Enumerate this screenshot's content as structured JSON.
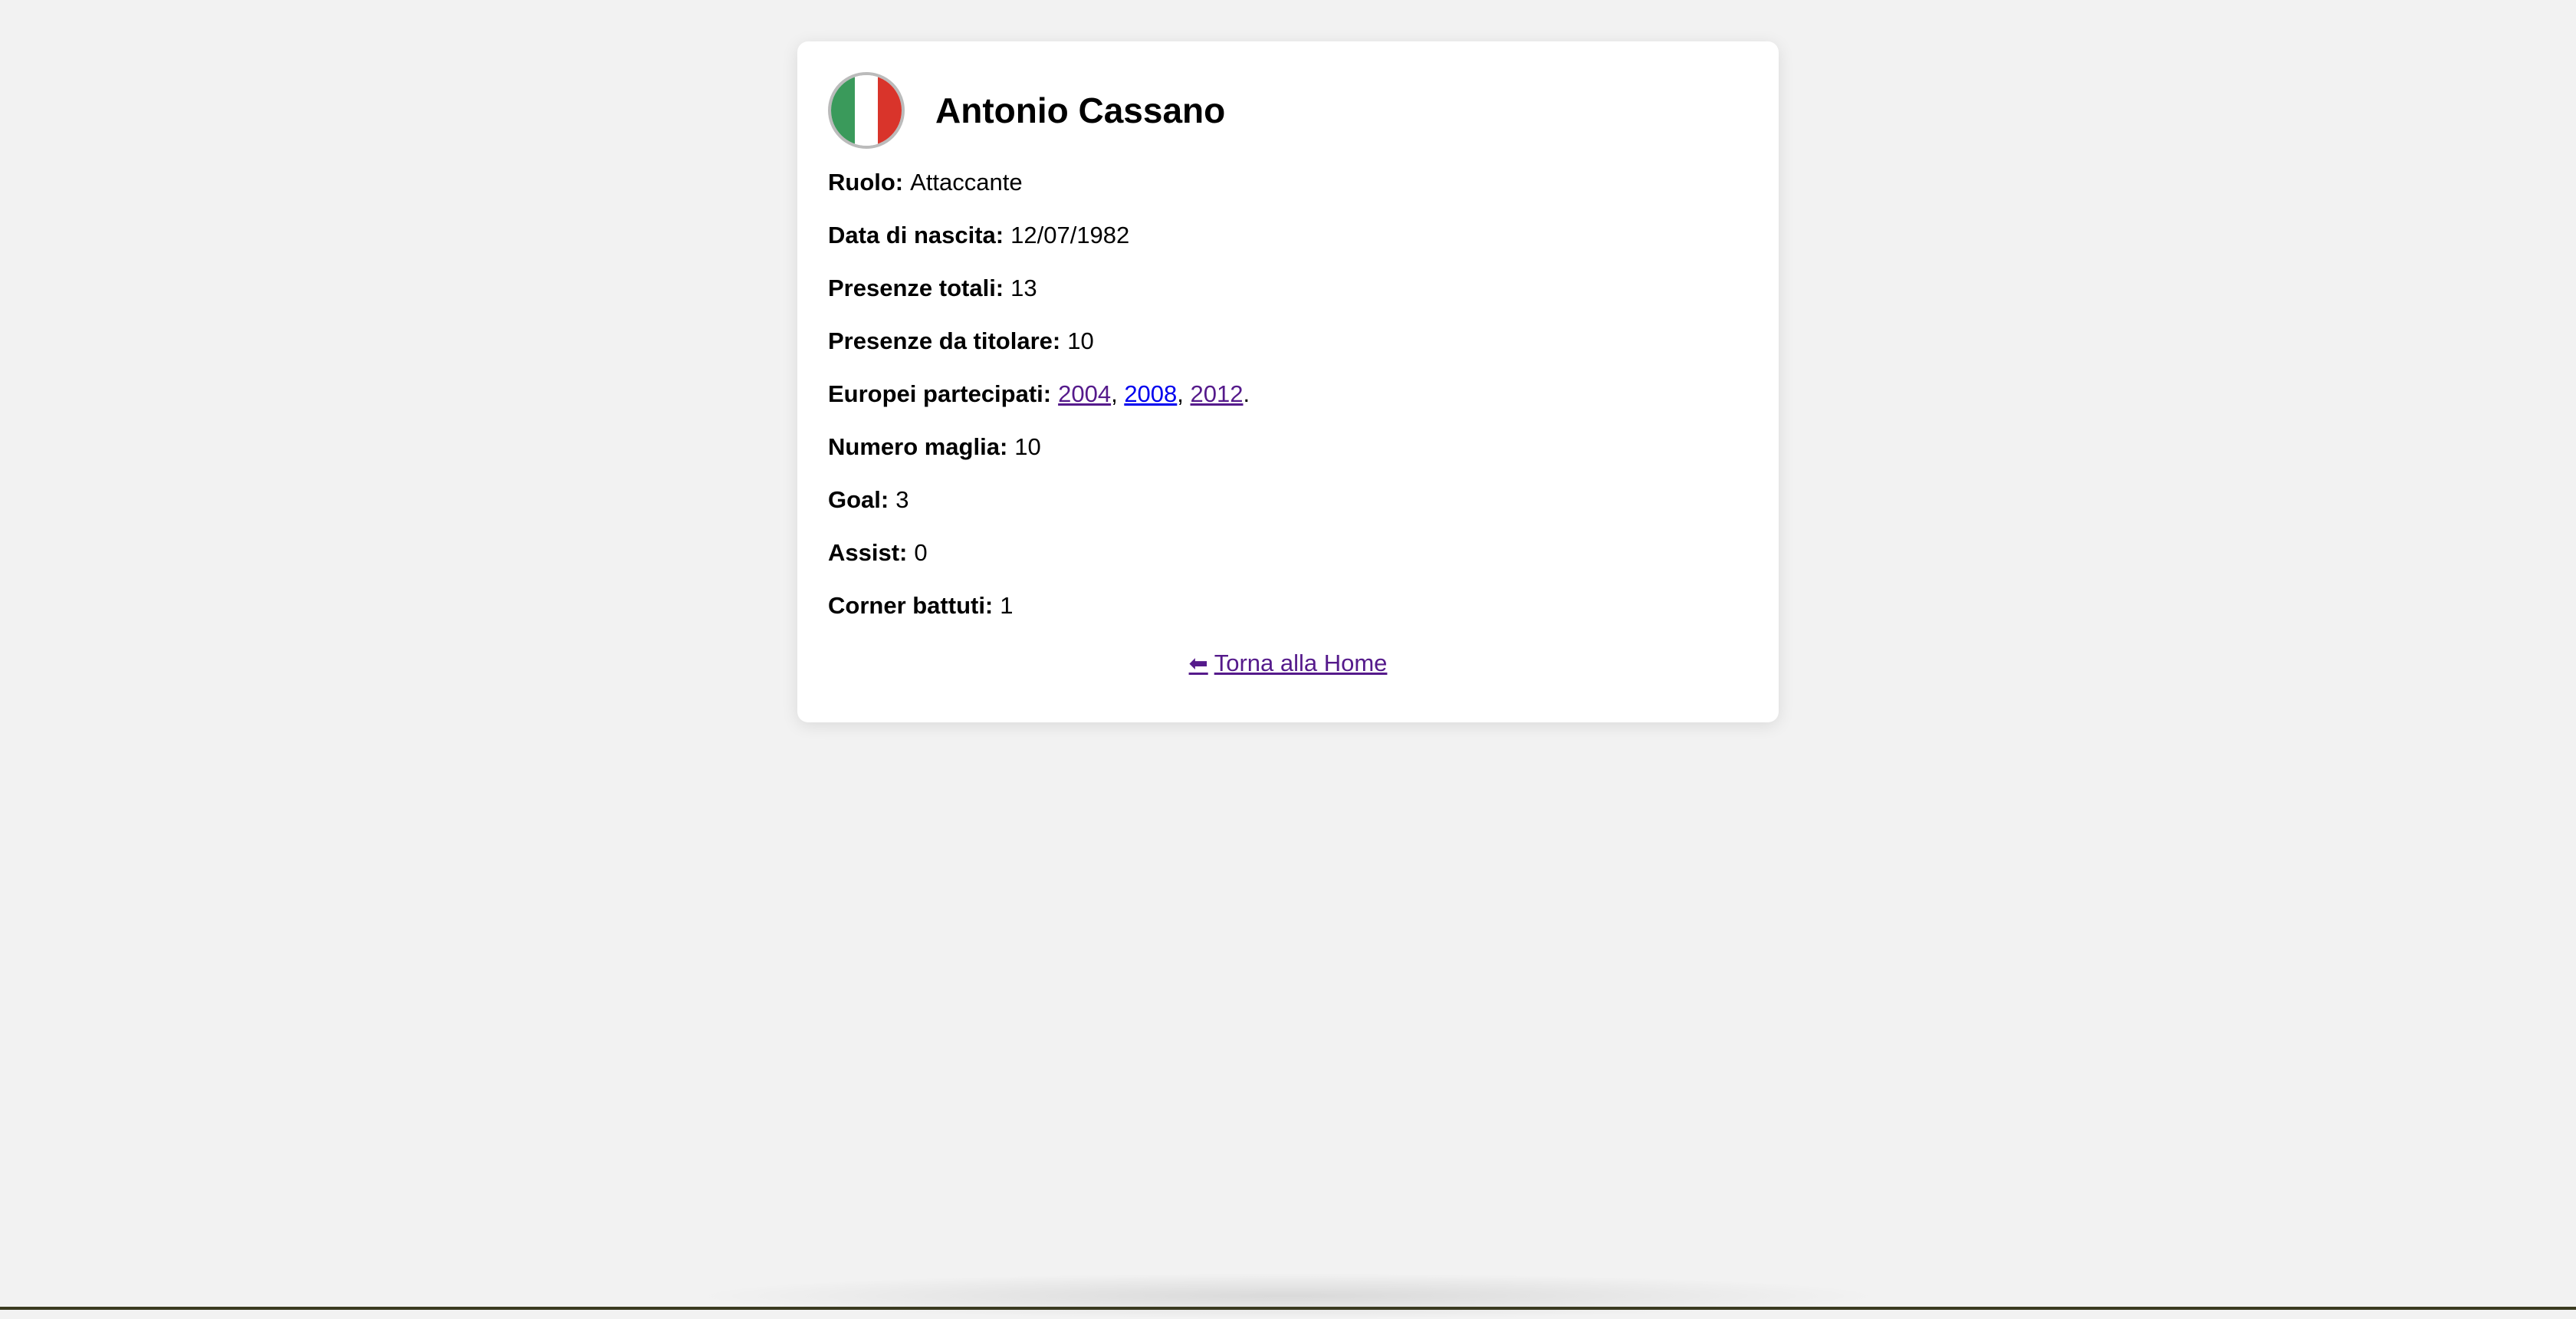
{
  "player": {
    "name": "Antonio Cassano",
    "flag_icon": "italy-flag-icon",
    "flag_colors": [
      "#3a9a5b",
      "#ffffff",
      "#d9342b"
    ]
  },
  "stats": [
    {
      "label": "Ruolo:",
      "value": "Attaccante"
    },
    {
      "label": "Data di nascita:",
      "value": "12/07/1982"
    },
    {
      "label": "Presenze totali:",
      "value": "13"
    },
    {
      "label": "Presenze da titolare:",
      "value": "10"
    },
    {
      "label": "Europei partecipati:",
      "links": [
        "2004",
        "2008",
        "2012"
      ],
      "separator": ", ",
      "suffix": "."
    },
    {
      "label": "Numero maglia:",
      "value": "10"
    },
    {
      "label": "Goal:",
      "value": "3"
    },
    {
      "label": "Assist:",
      "value": "0"
    },
    {
      "label": "Corner battuti:",
      "value": "1"
    }
  ],
  "nav": {
    "home_icon": "arrow-left-icon",
    "home_arrow": "⬅",
    "home_label": "Torna alla Home"
  },
  "colors": {
    "background": "#f2f2f2",
    "card": "#ffffff",
    "visited_link": "#551a8b",
    "unvisited_link": "#0000ee"
  }
}
